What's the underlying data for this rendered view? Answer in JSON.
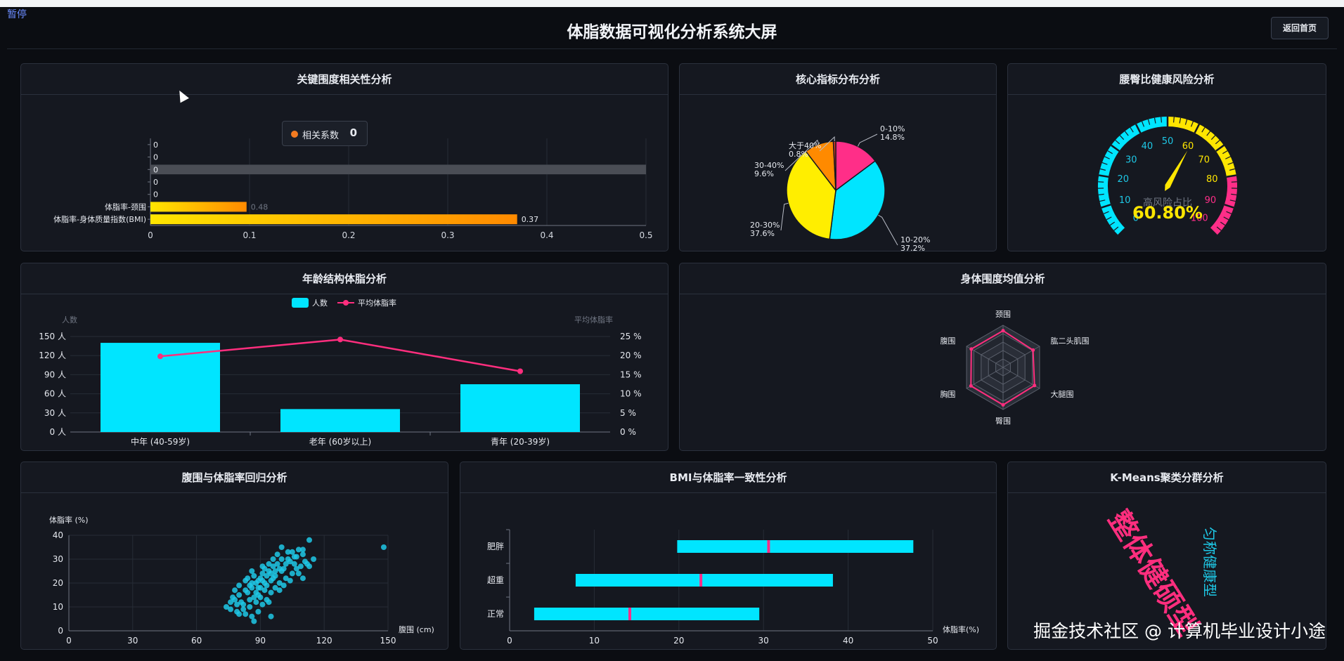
{
  "app": {
    "pause_label": "暂停",
    "title": "体脂数据可视化分析系统大屏",
    "back_label": "返回首页",
    "watermark": "掘金技术社区 @ 计算机毕业设计小途"
  },
  "panels": {
    "correlation": {
      "title": "关键围度相关性分析",
      "tooltip_label": "相关系数",
      "tooltip_value": "0"
    },
    "distribution": {
      "title": "核心指标分布分析"
    },
    "gauge": {
      "title": "腰臀比健康风险分析",
      "inner_label": "高风险占比",
      "value_text": "60.80%",
      "value": 60.8
    },
    "age": {
      "title": "年龄结构体脂分析"
    },
    "radar": {
      "title": "身体围度均值分析"
    },
    "scatter": {
      "title": "腹围与体脂率回归分析"
    },
    "bmi": {
      "title": "BMI与体脂率一致性分析"
    },
    "kmeans": {
      "title": "K-Means聚类分群分析"
    }
  },
  "chart_data": [
    {
      "id": "correlation",
      "type": "bar",
      "orientation": "horizontal",
      "categories": [
        "",
        "",
        "",
        "",
        "",
        "体脂率-颈围",
        "体脂率-身体质量指数(BMI)"
      ],
      "values": [
        0,
        0,
        0,
        0,
        0,
        0.48,
        0.37
      ],
      "value_labels": [
        "0",
        "0",
        "0",
        "0",
        "0",
        "0.48",
        "0.37"
      ],
      "xlim": [
        0,
        0.5
      ],
      "xticks": [
        "0",
        "0.1",
        "0.2",
        "0.3",
        "0.4",
        "0.5"
      ],
      "highlight_index": 2,
      "colors": [
        "#ffe600",
        "#ff8a00"
      ]
    },
    {
      "id": "distribution",
      "type": "pie",
      "slices": [
        {
          "label": "0-10%",
          "pct": "14.8%",
          "value": 14.8,
          "color": "#ff2e88"
        },
        {
          "label": "10-20%",
          "pct": "37.2%",
          "value": 37.2,
          "color": "#00e5ff"
        },
        {
          "label": "20-30%",
          "pct": "37.6%",
          "value": 37.6,
          "color": "#ffee00"
        },
        {
          "label": "30-40%",
          "pct": "9.6%",
          "value": 9.6,
          "color": "#ff8a00"
        },
        {
          "label": "大于40%",
          "pct": "0.8%",
          "value": 0.8,
          "color": "#d93a2b"
        }
      ]
    },
    {
      "id": "gauge",
      "type": "gauge",
      "min": 0,
      "max": 100,
      "value": 60.8,
      "ticks": [
        "0",
        "10",
        "20",
        "30",
        "40",
        "50",
        "60",
        "70",
        "80",
        "90",
        "100"
      ],
      "bands": [
        {
          "to": 50,
          "color": "#00e5ff"
        },
        {
          "to": 80,
          "color": "#ffe600"
        },
        {
          "to": 100,
          "color": "#ff2e88"
        }
      ]
    },
    {
      "id": "age",
      "type": "bar",
      "categories": [
        "中年 (40-59岁)",
        "老年 (60岁以上)",
        "青年 (20-39岁)"
      ],
      "series": [
        {
          "name": "人数",
          "values": [
            140,
            36,
            75
          ],
          "color": "#00e5ff"
        },
        {
          "name": "平均体脂率",
          "values": [
            19.8,
            24.2,
            15.9
          ],
          "color": "#ff2e7e"
        }
      ],
      "ylabel": "人数",
      "ylabel_right": "平均体脂率",
      "ylim": [
        0,
        150
      ],
      "ylim_right": [
        0,
        25
      ],
      "yticks": [
        "0 人",
        "30 人",
        "60 人",
        "90 人",
        "120 人",
        "150 人"
      ],
      "yticks_right": [
        "0 %",
        "5 %",
        "10 %",
        "15 %",
        "20 %",
        "25 %"
      ]
    },
    {
      "id": "radar",
      "type": "radar",
      "indicators": [
        "颈围",
        "肱二头肌围",
        "大腿围",
        "臀围",
        "胸围",
        "腹围"
      ],
      "values": [
        0.87,
        0.82,
        0.86,
        0.89,
        0.88,
        0.87
      ],
      "color": "#ff2e7e"
    },
    {
      "id": "scatter",
      "type": "scatter",
      "xlabel": "腹围 (cm)",
      "ylabel": "体脂率 (%)",
      "xlim": [
        0,
        150
      ],
      "ylim": [
        0,
        40
      ],
      "xticks": [
        "0",
        "30",
        "60",
        "90",
        "120",
        "150"
      ],
      "yticks": [
        "0",
        "10",
        "20",
        "30",
        "40"
      ],
      "color": "#1ec8e6",
      "points": [
        [
          148,
          35
        ],
        [
          113,
          38
        ],
        [
          108,
          34
        ],
        [
          103,
          33
        ],
        [
          110,
          32
        ],
        [
          115,
          30
        ],
        [
          112,
          28
        ],
        [
          106,
          31
        ],
        [
          104,
          29
        ],
        [
          100,
          30
        ],
        [
          98,
          28
        ],
        [
          101,
          26
        ],
        [
          96,
          27
        ],
        [
          94,
          25
        ],
        [
          97,
          23
        ],
        [
          92,
          26
        ],
        [
          90,
          22
        ],
        [
          95,
          21
        ],
        [
          93,
          19
        ],
        [
          88,
          20
        ],
        [
          91,
          24
        ],
        [
          86,
          18
        ],
        [
          84,
          16
        ],
        [
          89,
          15
        ],
        [
          87,
          14
        ],
        [
          85,
          13
        ],
        [
          83,
          17
        ],
        [
          80,
          15
        ],
        [
          78,
          13
        ],
        [
          82,
          11
        ],
        [
          76,
          9
        ],
        [
          79,
          8
        ],
        [
          74,
          10
        ],
        [
          81,
          12
        ],
        [
          77,
          14
        ],
        [
          83,
          7
        ],
        [
          86,
          6
        ],
        [
          89,
          8
        ],
        [
          91,
          11
        ],
        [
          93,
          13
        ],
        [
          95,
          16
        ],
        [
          97,
          18
        ],
        [
          99,
          20
        ],
        [
          102,
          22
        ],
        [
          105,
          24
        ],
        [
          107,
          26
        ],
        [
          109,
          27
        ],
        [
          111,
          29
        ],
        [
          100,
          25
        ],
        [
          96,
          22
        ],
        [
          92,
          20
        ],
        [
          90,
          18
        ],
        [
          88,
          16
        ],
        [
          86,
          20
        ],
        [
          84,
          22
        ],
        [
          94,
          28
        ],
        [
          98,
          32
        ],
        [
          103,
          30
        ],
        [
          106,
          28
        ],
        [
          108,
          24
        ],
        [
          110,
          22
        ],
        [
          92,
          17
        ],
        [
          88,
          12
        ],
        [
          85,
          10
        ],
        [
          82,
          9
        ],
        [
          80,
          7
        ],
        [
          87,
          4
        ],
        [
          95,
          6
        ],
        [
          78,
          17
        ],
        [
          76,
          12
        ],
        [
          90,
          14
        ],
        [
          94,
          12
        ],
        [
          99,
          17
        ],
        [
          101,
          19
        ],
        [
          104,
          21
        ],
        [
          113,
          27
        ],
        [
          96,
          30
        ],
        [
          91,
          27
        ],
        [
          86,
          25
        ],
        [
          83,
          21
        ],
        [
          80,
          19
        ],
        [
          79,
          11
        ],
        [
          97,
          25
        ],
        [
          93,
          23
        ],
        [
          89,
          21
        ],
        [
          87,
          23
        ],
        [
          85,
          19
        ],
        [
          100,
          35
        ],
        [
          105,
          33
        ],
        [
          110,
          34
        ],
        [
          107,
          31
        ],
        [
          102,
          28
        ],
        [
          99,
          26
        ],
        [
          95,
          24
        ],
        [
          91,
          21
        ],
        [
          89,
          18
        ]
      ]
    },
    {
      "id": "bmi",
      "type": "boxplot",
      "orientation": "horizontal",
      "categories": [
        "肥胖",
        "超重",
        "正常"
      ],
      "xlabel": "体脂率(%)",
      "xlim": [
        0,
        50
      ],
      "xticks": [
        "0",
        "10",
        "20",
        "30",
        "40",
        "50"
      ],
      "boxes": [
        {
          "name": "肥胖",
          "min": 19.8,
          "median": 30.6,
          "max": 47.7
        },
        {
          "name": "超重",
          "min": 7.8,
          "median": 22.6,
          "max": 38.2
        },
        {
          "name": "正常",
          "min": 2.9,
          "median": 14.2,
          "max": 29.5
        }
      ],
      "color": "#00e5ff",
      "median_color": "#ff2e88"
    },
    {
      "id": "kmeans",
      "type": "other",
      "words": [
        {
          "text": "整体健硕型",
          "color": "#ff2e7e"
        },
        {
          "text": "匀称健康型",
          "color": "#1ec8e6"
        }
      ]
    }
  ]
}
